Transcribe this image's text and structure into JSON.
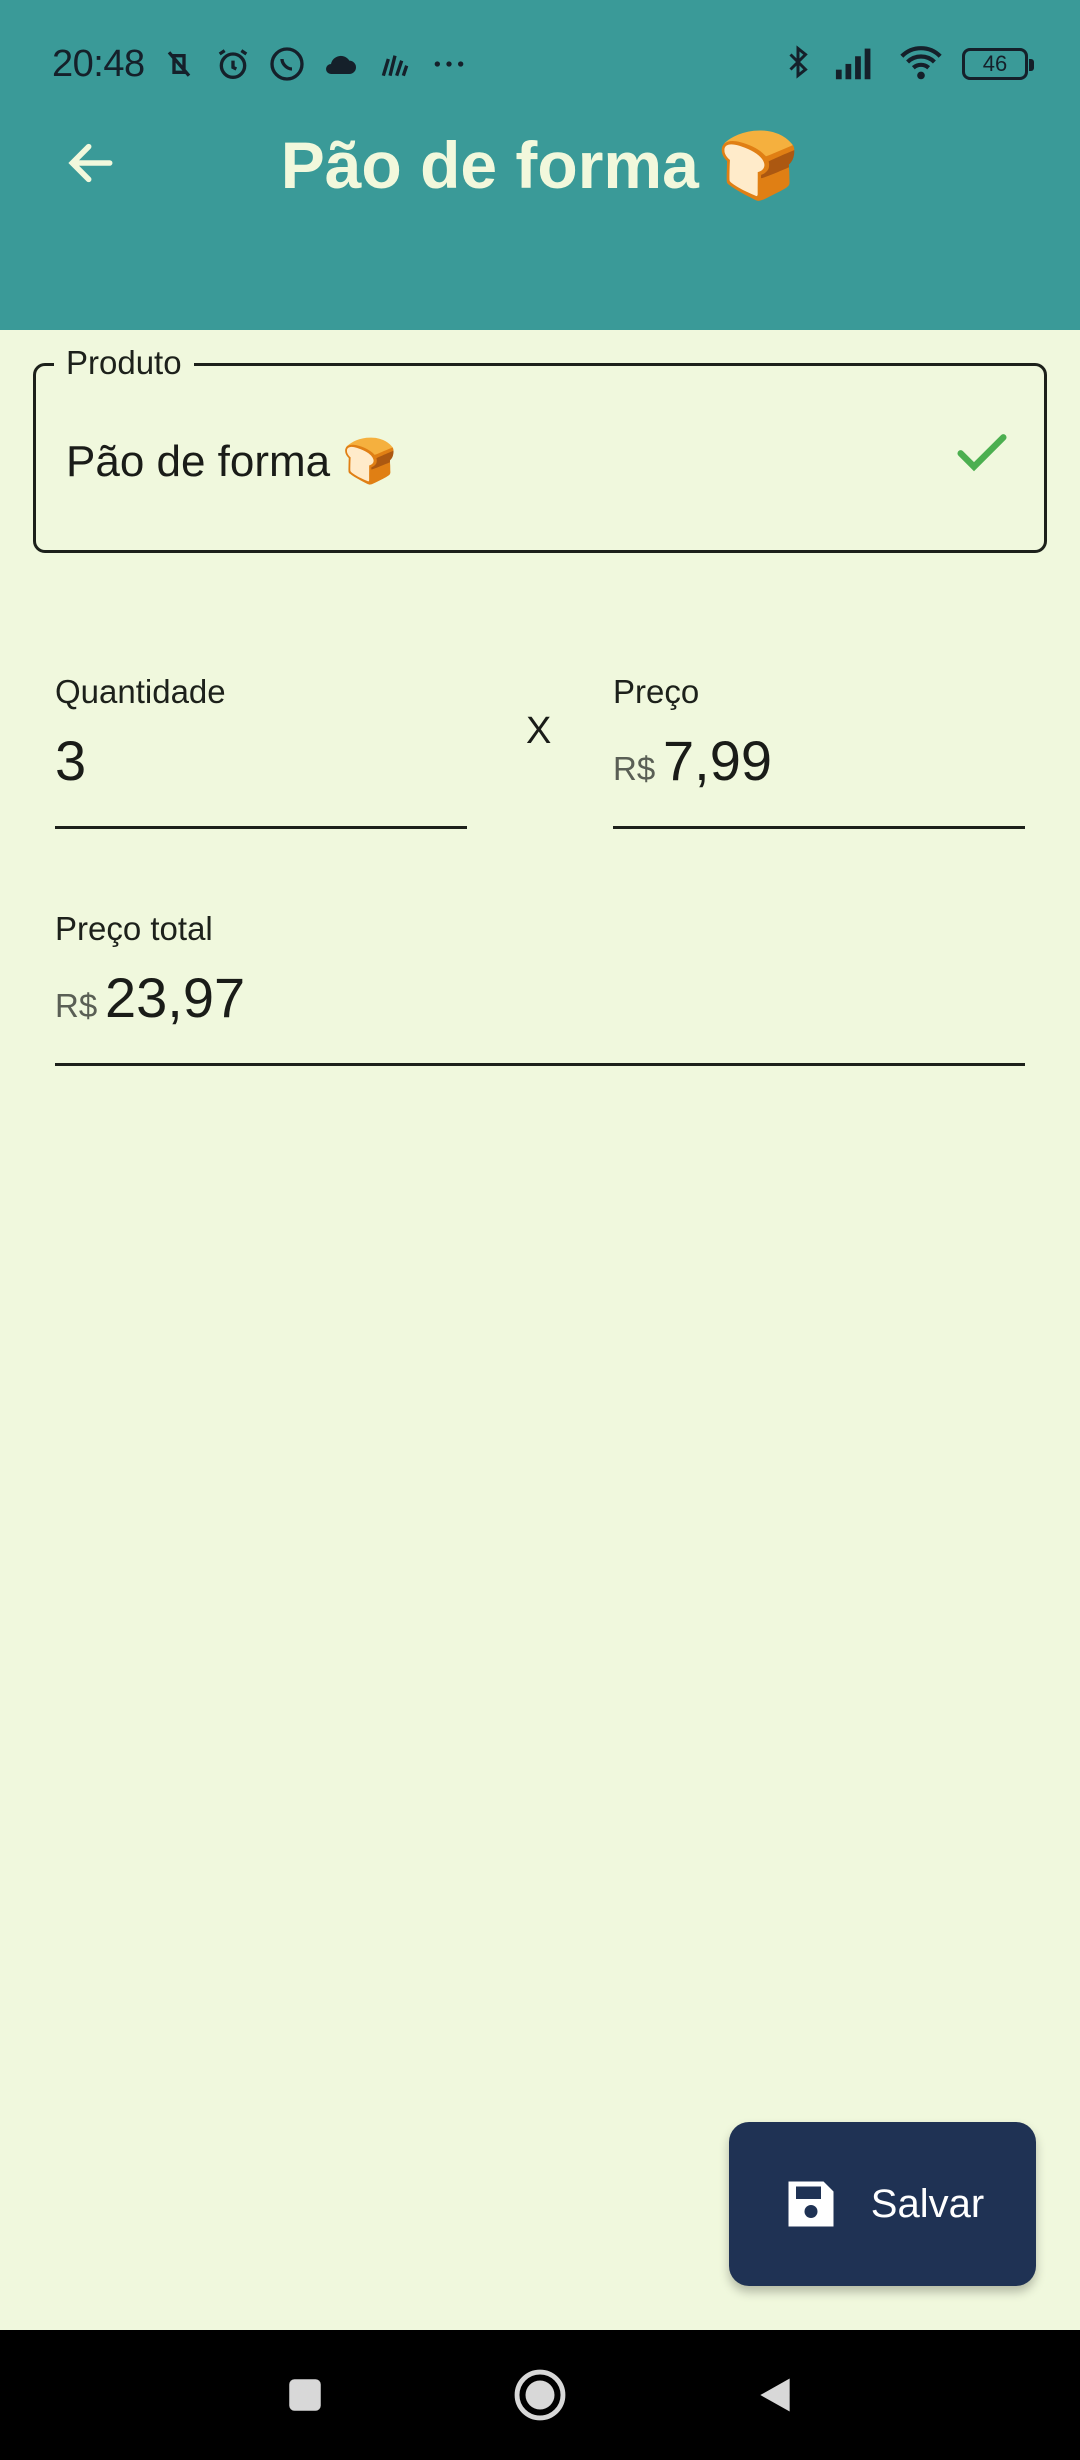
{
  "status": {
    "time": "20:48",
    "battery": "46",
    "icons_left": [
      "muted-vibrate-icon",
      "alarm-icon",
      "whatsapp-icon",
      "cloud-icon",
      "signal-app-icon",
      "more-icon"
    ],
    "icons_right": [
      "bluetooth-icon",
      "cell-signal-icon",
      "wifi-icon",
      "battery-icon"
    ]
  },
  "header": {
    "title": "Pão de forma 🍞",
    "back_icon": "arrow-left-icon",
    "background": "#3a9a98",
    "title_color": "#f2f8dc"
  },
  "form": {
    "produto": {
      "label": "Produto",
      "value": "Pão de forma 🍞",
      "valid_icon": "check-icon",
      "valid_color": "#4caf50"
    },
    "quantidade": {
      "label": "Quantidade",
      "value": "3"
    },
    "times": "X",
    "preco": {
      "label": "Preço",
      "prefix": "R$",
      "value": "7,99"
    },
    "preco_total": {
      "label": "Preço total",
      "prefix": "R$",
      "value": "23,97"
    }
  },
  "fab": {
    "label": "Salvar",
    "icon": "save-icon",
    "background": "#1f3254"
  },
  "navbar": {
    "buttons": [
      "recents-button",
      "home-button",
      "back-button"
    ]
  },
  "background": "#f0f8dd"
}
